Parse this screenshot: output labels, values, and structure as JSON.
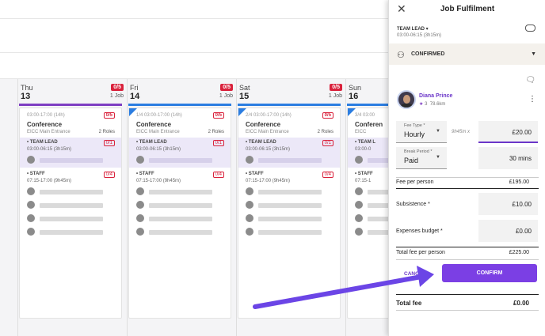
{
  "scheduler": {
    "days": [
      {
        "name": "Thu",
        "num": "13",
        "badge": "0/5",
        "jobs": "1 Job",
        "corner": false
      },
      {
        "name": "Fri",
        "num": "14",
        "badge": "0/5",
        "jobs": "1 Job",
        "corner": true
      },
      {
        "name": "Sat",
        "num": "15",
        "badge": "0/5",
        "jobs": "1 Job",
        "corner": true
      },
      {
        "name": "Sun",
        "num": "16",
        "badge": "",
        "jobs": "",
        "corner": true
      }
    ],
    "cards": [
      {
        "time": "03:00-17:00 (14h)",
        "badge": "0/5",
        "title": "Conference",
        "location": "EICC Main Entrance",
        "roles": "2 Roles",
        "lead_name": "• TEAM LEAD",
        "lead_time": "03:00-06:15 (3h15m)",
        "lead_badge": "0/1",
        "staff_name": "• STAFF",
        "staff_time": "07:15-17:00 (9h45m)",
        "staff_badge": "0/4"
      },
      {
        "time": "1/4 03:00-17:00 (14h)",
        "badge": "0/5",
        "title": "Conference",
        "location": "EICC Main Entrance",
        "roles": "2 Roles",
        "lead_name": "• TEAM LEAD",
        "lead_time": "03:00-06:15 (3h15m)",
        "lead_badge": "0/1",
        "staff_name": "• STAFF",
        "staff_time": "07:15-17:00 (9h45m)",
        "staff_badge": "0/4"
      },
      {
        "time": "2/4 03:00-17:00 (14h)",
        "badge": "0/5",
        "title": "Conference",
        "location": "EICC Main Entrance",
        "roles": "2 Roles",
        "lead_name": "• TEAM LEAD",
        "lead_time": "03:00-06:15 (3h15m)",
        "lead_badge": "0/1",
        "staff_name": "• STAFF",
        "staff_time": "07:15-17:00 (9h45m)",
        "staff_badge": "0/4"
      },
      {
        "time": "3/4 03:00",
        "badge": "",
        "title": "Conferen",
        "location": "EICC",
        "roles": "",
        "lead_name": "• TEAM L",
        "lead_time": "03:00-0",
        "lead_badge": "",
        "staff_name": "• STAFF",
        "staff_time": "07:15-1",
        "staff_badge": ""
      }
    ]
  },
  "panel": {
    "close_icon": "close-icon",
    "title": "Job Fulfilment",
    "role": "TEAM LEAD ▾",
    "role_time": "03:00-06:15 (3h15m)",
    "status": "CONFIRMED",
    "person": {
      "name": "Diana Prince",
      "rating": "3",
      "distance": "78.6km"
    },
    "fee_type": {
      "label": "Fee Type *",
      "value": "Hourly"
    },
    "multiplier": "9h45m x",
    "hourly_amount": "£20.00",
    "break_period": {
      "label": "Break Period *",
      "value": "Paid"
    },
    "break_duration": "30 mins",
    "fee_per_person": {
      "label": "Fee per person",
      "value": "£195.00"
    },
    "subsistence": {
      "label": "Subsistence *",
      "value": "£10.00"
    },
    "expenses": {
      "label": "Expenses budget *",
      "value": "£0.00"
    },
    "total_per_person": {
      "label": "Total fee per person",
      "value": "£225.00"
    },
    "cancel_label": "CANCEL",
    "confirm_label": "CONFIRM",
    "total_fee": {
      "label": "Total fee",
      "value": "£0.00"
    },
    "accent": "#7b3fe4"
  }
}
